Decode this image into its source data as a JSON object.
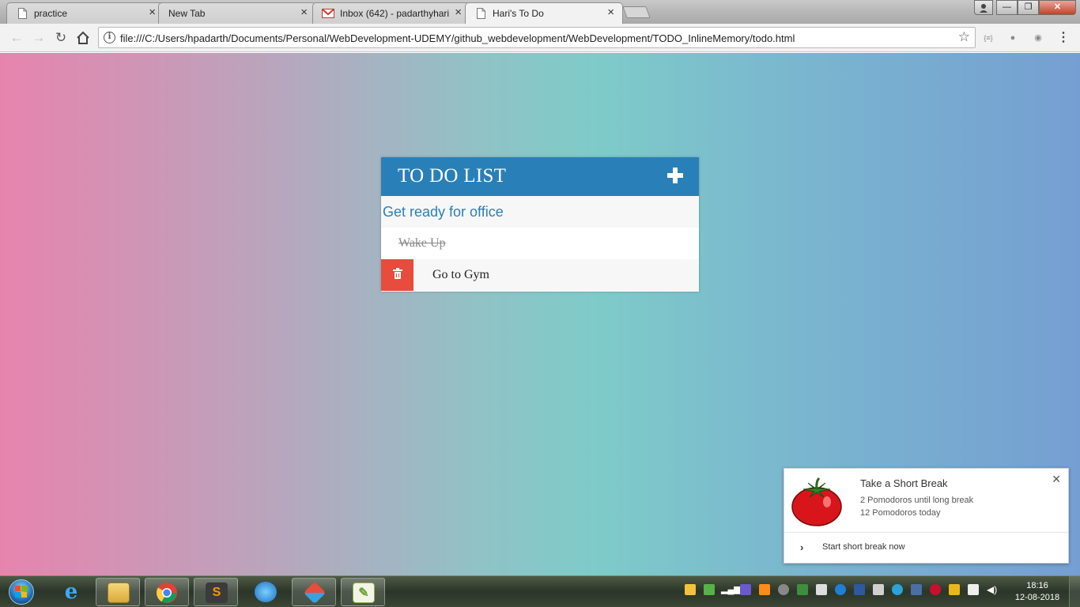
{
  "browser": {
    "tabs": [
      {
        "label": "practice",
        "icon": "page-icon",
        "active": false
      },
      {
        "label": "New Tab",
        "icon": "none",
        "active": false
      },
      {
        "label": "Inbox (642) - padarthyhari",
        "icon": "gmail-icon",
        "active": false
      },
      {
        "label": "Hari's To Do",
        "icon": "page-icon",
        "active": true
      }
    ],
    "tab_close_glyph": "×",
    "url": "file:///C:/Users/hpadarth/Documents/Personal/WebDevelopment-UDEMY/github_webdevelopment/WebDevelopment/TODO_InlineMemory/todo.html",
    "window_buttons": {
      "minimize": "—",
      "maximize": "❐",
      "close": "✕"
    }
  },
  "todo": {
    "title": "TO DO LIST",
    "input_value": "Get ready for office",
    "items": [
      {
        "text": "Wake Up",
        "completed": true
      },
      {
        "text": "Go to Gym",
        "completed": false
      }
    ]
  },
  "notification": {
    "title": "Take a Short Break",
    "line1": "2 Pomodoros until long break",
    "line2": "12 Pomodoros today",
    "action": "Start short break now"
  },
  "taskbar": {
    "apps": [
      "internet-explorer",
      "file-explorer",
      "chrome",
      "sublime-text",
      "app-blue",
      "app-diamond",
      "notepad-plus"
    ],
    "clock_time": "18:16",
    "clock_date": "12-08-2018"
  },
  "colors": {
    "header_blue": "#2980b9",
    "delete_red": "#e74c3c",
    "input_text_blue": "#2980b9"
  }
}
